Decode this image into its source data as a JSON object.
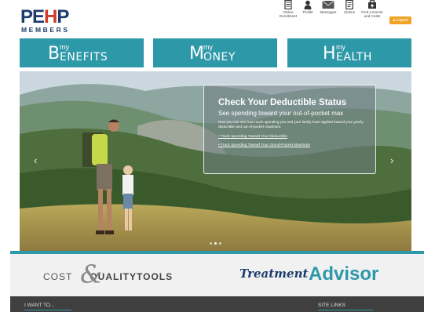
{
  "logo": {
    "main_a": "PE",
    "main_h": "H",
    "main_p": "P",
    "sub": "MEMBERS"
  },
  "header_nav": [
    {
      "label": "Online\nEnrollment",
      "icon": "enrollment-icon"
    },
    {
      "label": "Profile",
      "icon": "profile-icon"
    },
    {
      "label": "Messages",
      "icon": "envelope-icon"
    },
    {
      "label": "Claims",
      "icon": "claims-icon"
    },
    {
      "label": "Find a Doctor\nand Costs",
      "icon": "find-doctor-icon"
    }
  ],
  "logout": {
    "label": "Logout"
  },
  "tiles": [
    {
      "my": "my",
      "big": "B",
      "rest": "ENEFITS"
    },
    {
      "my": "my",
      "big": "M",
      "rest": "ONEY"
    },
    {
      "my": "my",
      "big": "H",
      "rest": "EALTH"
    }
  ],
  "promo": {
    "title": "Check Your Deductible Status",
    "subtitle": "See spending toward your out-of-pocket max",
    "body": "Now you can see how much spending you and your family have applied toward your yearly deductible and out-of-pocket maximum.",
    "links": [
      "• Track Spending Toward Your Deductible",
      "• Track Spending Toward Your Out-of-Pocket Maximum"
    ]
  },
  "carousel": {
    "prev": "‹",
    "next": "›",
    "slides": 3,
    "active": 1
  },
  "tools": {
    "cost_a": "COST",
    "amp": "&",
    "cost_b": "QUALITYTOOLS",
    "treatment": "Treatment",
    "advisor": "Advisor"
  },
  "footer": {
    "left": "I WANT TO...",
    "right": "SITE LINKS"
  },
  "colors": {
    "teal": "#2d98a8",
    "navy": "#1d3b6b",
    "orange": "#f0a325",
    "footer": "#3f3f3f"
  }
}
